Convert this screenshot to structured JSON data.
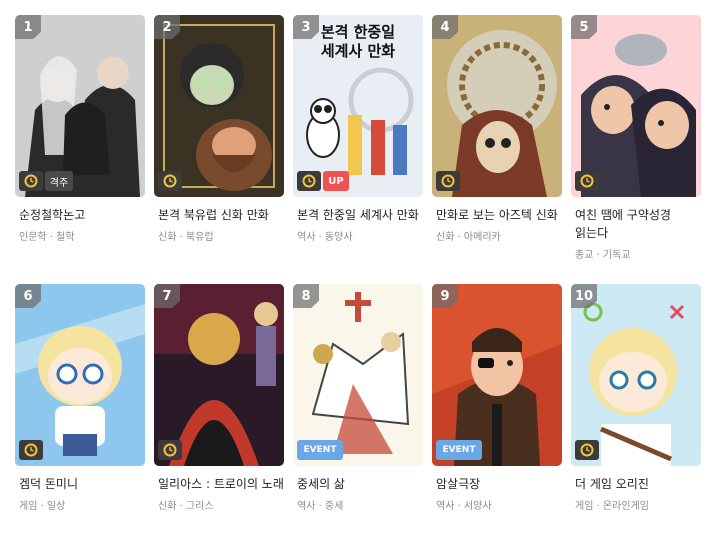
{
  "items": [
    {
      "rank": "1",
      "title": "순정철학논고",
      "genre": "인문학 · 철학",
      "badges": {
        "clock": true,
        "up": false,
        "week": "격주",
        "event": ""
      },
      "colors": [
        "#cfcfcf",
        "#2a2a2a",
        "#e8d6c8"
      ]
    },
    {
      "rank": "2",
      "title": "본격 북유럽 신화 만화",
      "genre": "신화 · 북유럽",
      "badges": {
        "clock": true,
        "up": false,
        "week": "",
        "event": ""
      },
      "colors": [
        "#3a3324",
        "#7a4a2c",
        "#b8e3a8"
      ]
    },
    {
      "rank": "3",
      "title": "본격 한중일 세계사 만화",
      "genre": "역사 · 동양사",
      "badges": {
        "clock": true,
        "up": true,
        "week": "",
        "event": ""
      },
      "cover_text": [
        "본격 한중일",
        "세계사 만화"
      ],
      "up_label": "UP",
      "colors": [
        "#e9eef4",
        "#222222",
        "#f3c64d"
      ]
    },
    {
      "rank": "4",
      "title": "만화로 보는 아즈텍 신화",
      "genre": "신화 · 아메리카",
      "badges": {
        "clock": true,
        "up": false,
        "week": "",
        "event": ""
      },
      "colors": [
        "#c9b27a",
        "#7b3a26",
        "#dde4ea"
      ]
    },
    {
      "rank": "5",
      "title": "여친 땜에 구약성경 읽는다",
      "genre": "종교 · 기독교",
      "badges": {
        "clock": true,
        "up": false,
        "week": "",
        "event": ""
      },
      "colors": [
        "#ffd4d8",
        "#3a3546",
        "#f0c6a8"
      ]
    },
    {
      "rank": "6",
      "title": "겜덕 돈미니",
      "genre": "게임 · 일상",
      "badges": {
        "clock": true,
        "up": false,
        "week": "",
        "event": ""
      },
      "colors": [
        "#8ec7ee",
        "#f5e3a0",
        "#2f6fb8"
      ]
    },
    {
      "rank": "7",
      "title": "일리아스 : 트로이의 노래",
      "genre": "신화 · 그리스",
      "badges": {
        "clock": true,
        "up": false,
        "week": "",
        "event": ""
      },
      "colors": [
        "#2a1a28",
        "#c0392b",
        "#d8a84a"
      ]
    },
    {
      "rank": "8",
      "title": "중세의 삶",
      "genre": "역사 · 중세",
      "badges": {
        "clock": false,
        "up": false,
        "week": "",
        "event": "EVENT"
      },
      "colors": [
        "#fbf6ea",
        "#c44a3a",
        "#cfa84e"
      ]
    },
    {
      "rank": "9",
      "title": "암살극장",
      "genre": "역사 · 서양사",
      "badges": {
        "clock": false,
        "up": false,
        "week": "",
        "event": "EVENT"
      },
      "colors": [
        "#c44128",
        "#4a2e1e",
        "#f2c4a4"
      ]
    },
    {
      "rank": "10",
      "title": "더 게임 오리진",
      "genre": "게임 · 온라인게임",
      "badges": {
        "clock": true,
        "up": false,
        "week": "",
        "event": ""
      },
      "colors": [
        "#cdeaf4",
        "#f5e3a0",
        "#7a4a2a"
      ]
    }
  ]
}
